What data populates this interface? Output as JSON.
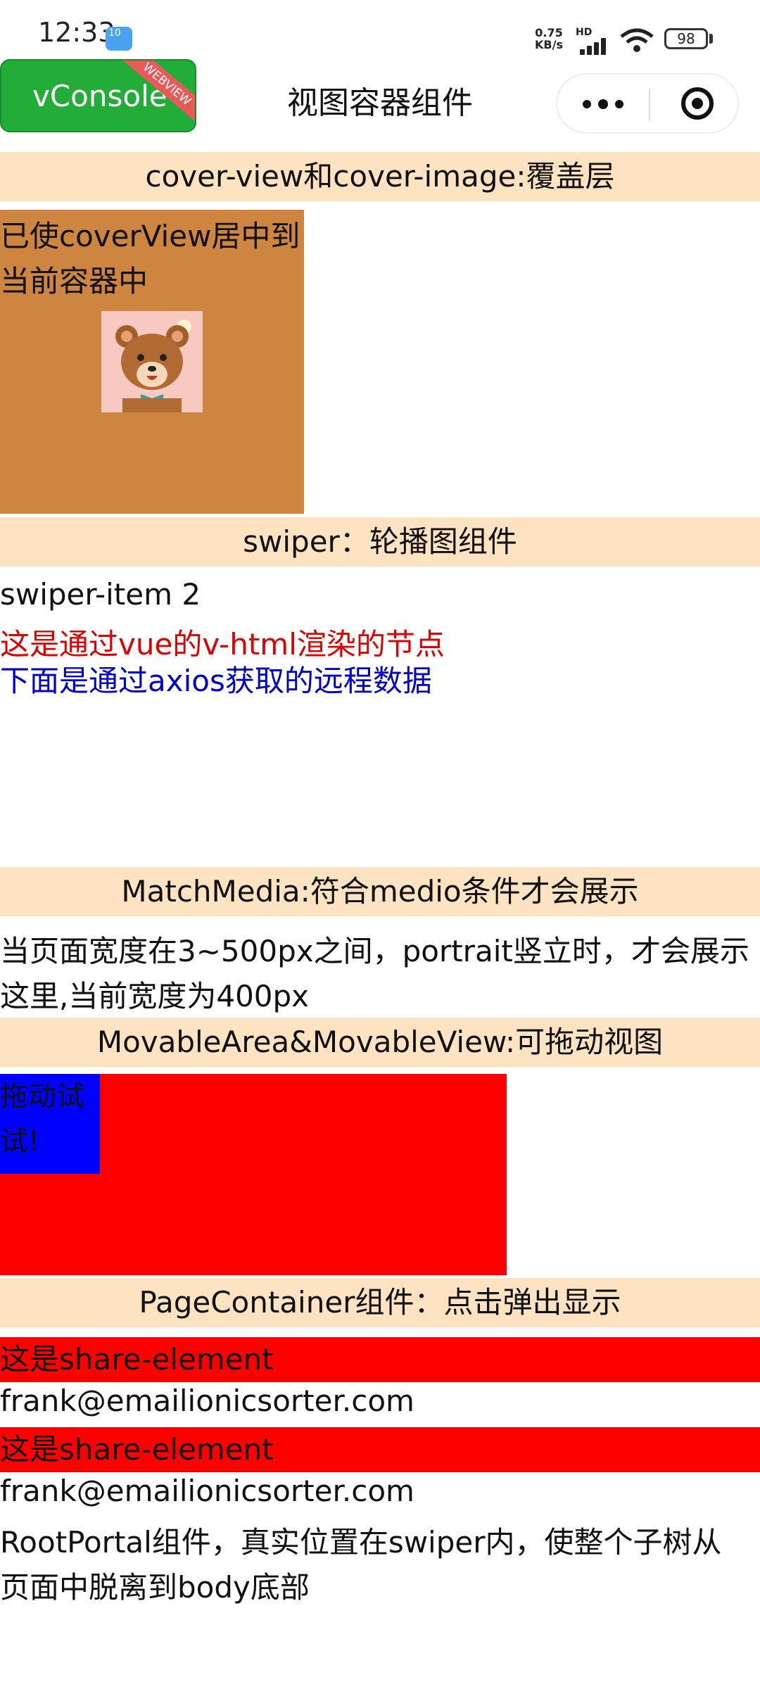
{
  "status": {
    "time": "12:33",
    "notification_badge": "10",
    "net_speed_top": "0.75",
    "net_speed_bottom": "KB/s",
    "hd": "HD",
    "battery": "98"
  },
  "nav": {
    "vconsole_label": "vConsole",
    "vconsole_ribbon": "WEBVIEW",
    "title": "视图容器组件"
  },
  "sections": {
    "cover": "cover-view和cover-image:覆盖层",
    "swiper": "swiper：轮播图组件",
    "match_media": "MatchMedia:符合medio条件才会展示",
    "movable": "MovableArea&MovableView:可拖动视图",
    "page_container": "PageContainer组件：点击弹出显示"
  },
  "cover": {
    "text": "已使coverView居中到当前容器中",
    "image_icon": "bear-icon"
  },
  "swiper": {
    "item_label": "swiper-item 2",
    "vhtml_text": "这是通过vue的v-html渲染的节点",
    "axios_text": "下面是通过axios获取的远程数据"
  },
  "match_media": {
    "text_line1": "当页面宽度在3~500px之间，portrait竖立时，才会展示",
    "text_line2": "这里,当前宽度为400px"
  },
  "movable": {
    "view_text": "拖动试试!"
  },
  "page_container": {
    "share_label_1": "这是share-element",
    "email_1": "frank@emailionicsorter.com",
    "share_label_2": "这是share-element",
    "email_2": "frank@emailionicsorter.com"
  },
  "root_portal": {
    "line1": "RootPortal组件，真实位置在swiper内，使整个子树从",
    "line2": "页面中脱离到body底部"
  },
  "colors": {
    "section_header_bg": "#fde3c2",
    "cover_bg": "#cd853f",
    "movable_area": "#ff0000",
    "movable_view": "#0000ff",
    "vconsole_green": "#22ac38",
    "vhtml_text": "#e00000",
    "axios_text": "#0000cc"
  }
}
